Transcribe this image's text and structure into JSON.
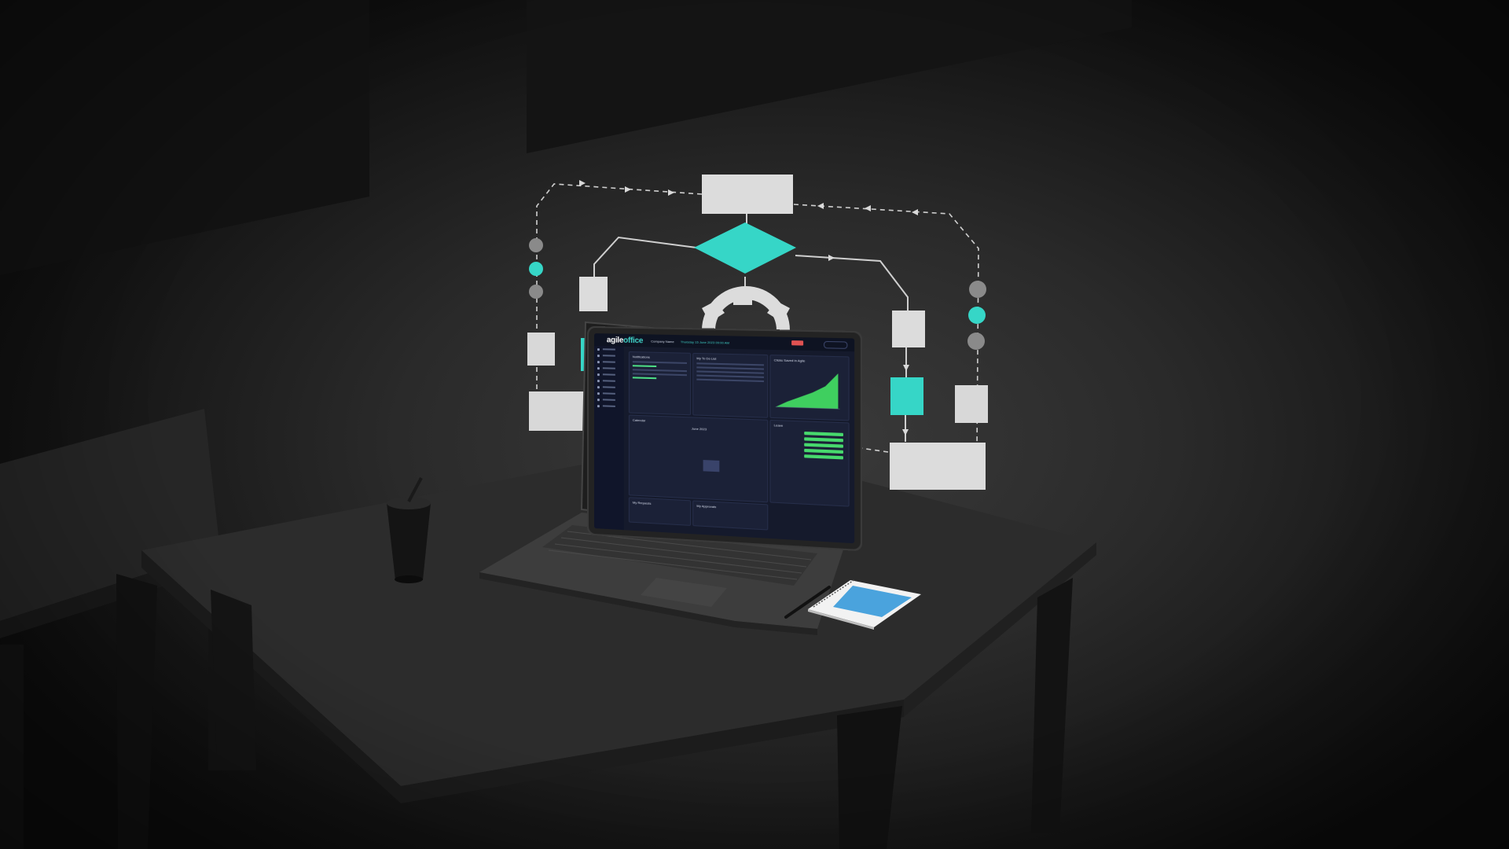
{
  "dashboard": {
    "logo_prefix": "agile",
    "logo_suffix": "office",
    "company": "Company Name",
    "datetime": "Thursday 15 June 2023 09:00 AM",
    "notifications_title": "Notifications",
    "todo_title": "My To Do List",
    "chart_title": "Clicks Saved in Agile",
    "calendar_title": "Calendar",
    "calendar_month": "June 2023",
    "leaves_title": "Leave",
    "requests_title": "My Requests",
    "approvals_title": "My Approvals",
    "sidebar_items": [
      "Dashboard",
      "Directory",
      "Request Manager",
      "Leave",
      "Expense",
      "Time",
      "Policies",
      "Reporting",
      "Timesheet",
      "Reports"
    ]
  },
  "colors": {
    "accent": "#3ad6c8",
    "shape": "#dcdcdc",
    "dot_gray": "#8a8a8a",
    "chart_green": "#3fcf5f"
  }
}
